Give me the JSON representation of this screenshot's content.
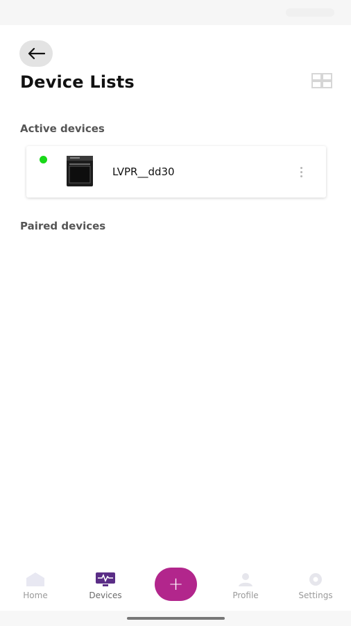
{
  "header": {
    "title": "Device Lists"
  },
  "sections": {
    "active_title": "Active devices",
    "paired_title": "Paired devices"
  },
  "active_devices": [
    {
      "name": "LVPR__dd30",
      "status": "online",
      "status_color": "#18d818"
    }
  ],
  "bottom_nav": {
    "items": [
      {
        "label": "Home",
        "icon": "home-icon"
      },
      {
        "label": "Devices",
        "icon": "devices-monitor-icon"
      },
      {
        "label": "Profile",
        "icon": "profile-icon"
      },
      {
        "label": "Settings",
        "icon": "settings-gear-icon"
      }
    ],
    "active": "Devices",
    "add_button_icon": "plus-icon"
  },
  "colors": {
    "accent": "#b2268c",
    "devices_icon": "#5a2d86",
    "online": "#18d818"
  }
}
